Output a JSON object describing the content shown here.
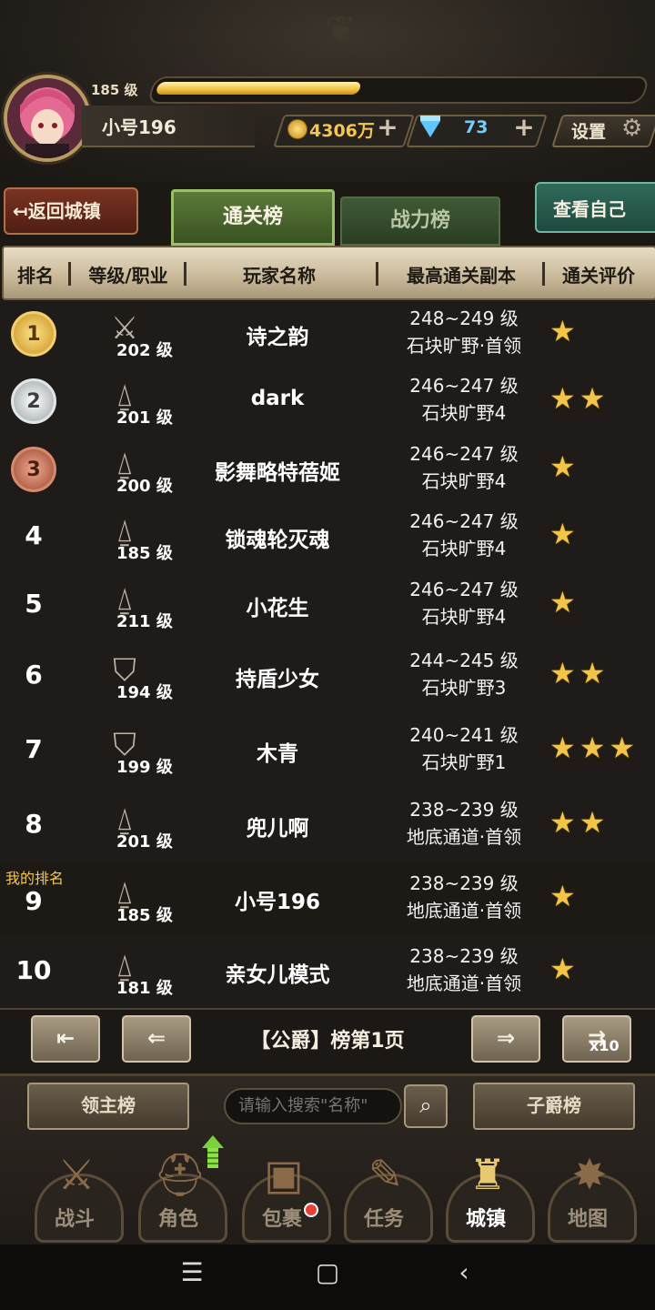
{
  "player": {
    "level": "185 级",
    "name": "小号196",
    "xp_fraction": 0.42,
    "gold": "4306万",
    "gems": "73"
  },
  "header": {
    "settings_label": "设置",
    "back_label": "↤返回城镇",
    "view_self_label": "查看自己"
  },
  "tabs": [
    {
      "label": "通关榜",
      "active": true
    },
    {
      "label": "战力榜",
      "active": false
    }
  ],
  "columns": [
    "排名",
    "等级/职业",
    "玩家名称",
    "最高通关副本",
    "通关评价"
  ],
  "rows": [
    {
      "rank": "1",
      "medal": "gold",
      "class_icon": "swords",
      "level": "202 级",
      "name": "诗之韵",
      "dungeon_level": "248~249 级",
      "dungeon_name": "石块旷野·首领",
      "stars": 1
    },
    {
      "rank": "2",
      "medal": "silver",
      "class_icon": "spire",
      "level": "201 级",
      "name": "dark",
      "dungeon_level": "246~247 级",
      "dungeon_name": "石块旷野4",
      "stars": 2
    },
    {
      "rank": "3",
      "medal": "bronze",
      "class_icon": "spire",
      "level": "200 级",
      "name": "影舞略特蓓姬",
      "dungeon_level": "246~247 级",
      "dungeon_name": "石块旷野4",
      "stars": 1
    },
    {
      "rank": "4",
      "class_icon": "spire",
      "level": "185 级",
      "name": "锁魂轮灭魂",
      "dungeon_level": "246~247 级",
      "dungeon_name": "石块旷野4",
      "stars": 1
    },
    {
      "rank": "5",
      "class_icon": "spire",
      "level": "211 级",
      "name": "小花生",
      "dungeon_level": "246~247 级",
      "dungeon_name": "石块旷野4",
      "stars": 1
    },
    {
      "rank": "6",
      "class_icon": "shield",
      "level": "194 级",
      "name": "持盾少女",
      "dungeon_level": "244~245 级",
      "dungeon_name": "石块旷野3",
      "stars": 2
    },
    {
      "rank": "7",
      "class_icon": "shield",
      "level": "199 级",
      "name": "木青",
      "dungeon_level": "240~241 级",
      "dungeon_name": "石块旷野1",
      "stars": 3
    },
    {
      "rank": "8",
      "class_icon": "spire",
      "level": "201 级",
      "name": "兜儿啊",
      "dungeon_level": "238~239 级",
      "dungeon_name": "地底通道·首领",
      "stars": 2
    },
    {
      "rank": "9",
      "class_icon": "spire",
      "level": "185 级",
      "name": "小号196",
      "dungeon_level": "238~239 级",
      "dungeon_name": "地底通道·首领",
      "stars": 1,
      "me": true
    },
    {
      "rank": "10",
      "class_icon": "spire",
      "level": "181 级",
      "name": "亲女儿模式",
      "dungeon_level": "238~239 级",
      "dungeon_name": "地底通道·首领",
      "stars": 1
    }
  ],
  "my_rank_label": "我的排名",
  "pager": {
    "text": "【公爵】榜第1页",
    "first": "⇤",
    "prev": "⇐",
    "next": "⇒",
    "jump": "⇉",
    "jump_label": "x10"
  },
  "bottom": {
    "left_button": "领主榜",
    "search_placeholder": "请输入搜索\"名称\"",
    "right_button": "子爵榜"
  },
  "nav": [
    {
      "label": "战斗",
      "icon": "battle-icon",
      "active": false
    },
    {
      "label": "角色",
      "icon": "helmet-icon",
      "active": false
    },
    {
      "label": "包裹",
      "icon": "bag-icon",
      "active": false
    },
    {
      "label": "任务",
      "icon": "scroll-icon",
      "active": false
    },
    {
      "label": "城镇",
      "icon": "castle-icon",
      "active": true
    },
    {
      "label": "地图",
      "icon": "map-icon",
      "active": false
    }
  ],
  "colors": {
    "gold": "#f4c650",
    "gem": "#6fd0ff",
    "star": "#f2c447",
    "tab_active": "#5c7a3a"
  }
}
